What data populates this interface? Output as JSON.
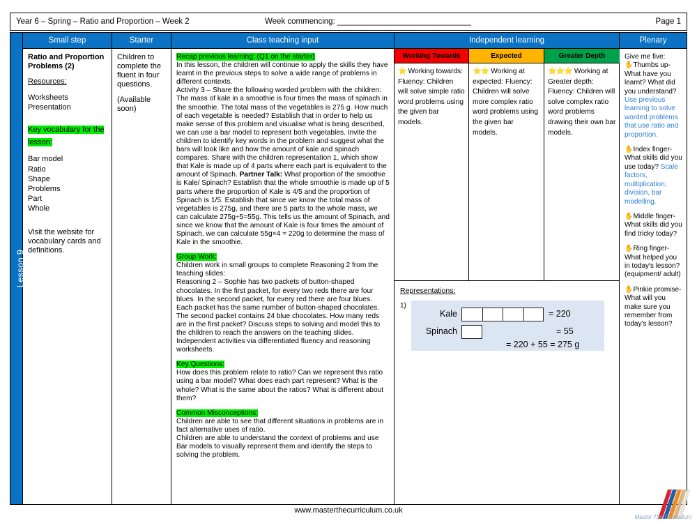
{
  "header": {
    "left": "Year 6 – Spring – Ratio and Proportion – Week 2",
    "week_commencing_label": "Week commencing: ______________________________",
    "page": "Page 1"
  },
  "spine": {
    "lesson_label": "Lesson 9"
  },
  "columns": {
    "small_step": "Small step",
    "starter": "Starter",
    "class_teaching_input": "Class teaching input",
    "independent_learning": "Independent learning",
    "plenary": "Plenary"
  },
  "small_step": {
    "title": "Ratio and Proportion Problems (2)",
    "resources_label": "Resources:",
    "resources": [
      "Worksheets",
      "Presentation"
    ],
    "vocab_heading": "Key vocabulary for the lesson:",
    "vocab": [
      "Bar model",
      "Ratio",
      "Shape",
      "Problems",
      "Part",
      "Whole"
    ],
    "footer_note": "Visit the website for vocabulary cards and definitions."
  },
  "starter": {
    "line1": "Children to complete the fluent in four questions.",
    "line2": "(Available soon)"
  },
  "teaching": {
    "recap_heading": "Recap previous learning: (Q1 on the starter)",
    "intro": "In this lesson, the children will continue to apply the skills they have learnt in the previous steps to solve a wide range of problems in different contexts.",
    "activity_part1": "Activity 3 – Share the following worded problem with the children: The mass of kale in a smoothie is four times the mass of spinach in the smoothie. The total mass of the vegetables is 275 g. How much of each vegetable is needed? Establish that in order to help us make sense of this problem and visualise what is being described, we can use a bar model to represent both vegetables. Invite the children to identify key words in the problem and suggest what the bars will look like and how the amount of kale and spinach compares. Share with the children representation 1, which show that Kale is made up of 4 parts where each part is equivalent to the amount of Spinach. ",
    "partner_talk_label": "Partner Talk:",
    "activity_part2": " What proportion of the smoothie is Kale/ Spinach? Establish that the whole smoothie is made up of 5 parts where the proportion of Kale is 4/5 and the proportion of Spinach is 1/5. Establish that since we know the total mass of vegetables is 275g, and there are 5 parts to the whole mass, we can calculate 275g÷5=55g. This tells us the amount of Spinach, and since we know that the amount of Kale is four times the amount of Spinach, we can calculate 55g×4 = 220g to determine the mass of Kale in the smoothie.",
    "group_work_heading": "Group Work:",
    "group_work": "Children work in small groups to complete Reasoning 2 from the teaching slides:",
    "reasoning": "Reasoning 2 – Sophie has two packets of button-shaped chocolates. In the first packet, for every two reds there are four blues. In the second packet, for every red there are four blues. Each packet has the same number of button-shaped chocolates. The second packet contains 24 blue chocolates. How many reds are in the first packet? Discuss steps to solving and model this to the children to reach the answers on the teaching slides.",
    "independent_note": "Independent activities via differentiated fluency and reasoning worksheets.",
    "key_questions_heading": "Key Questions:",
    "key_questions": "How does this problem relate to ratio? Can we represent this ratio using a bar model? What does each part represent? What is the whole? What is the same about the ratios? What is different about them?",
    "misconceptions_heading": "Common Misconceptions:",
    "misconception1": "Children are able to see that different situations in problems are in fact alternative uses of ratio.",
    "misconception2": "Children are able to understand the context of problems and use Bar models to visually represent them and identify the steps to solving the problem."
  },
  "differentiation": {
    "bands": [
      {
        "label": "Working Towards",
        "color": "#f20000",
        "stars": "⭐",
        "heading": "Working towards:",
        "body": "Fluency: Children will solve simple ratio word problems using the given bar models."
      },
      {
        "label": "Expected",
        "color": "#ffb400",
        "stars": "⭐⭐",
        "heading": "Working at expected:",
        "body": "Fluency: Children will solve more complex ratio word problems using the given bar models."
      },
      {
        "label": "Greater Depth",
        "color": "#00a14b",
        "stars": "⭐⭐⭐",
        "heading": "Working at Greater depth:",
        "body": "Fluency: Children will solve complex ratio word problems drawing their own bar models."
      }
    ]
  },
  "representations": {
    "title": "Representations:",
    "number": "1)",
    "bar_model": {
      "row1_label": "Kale",
      "row1_parts": 4,
      "row1_value": "= 220",
      "row2_label": "Spinach",
      "row2_parts": 1,
      "row2_value": "= 55",
      "total": "= 220 + 55 = 275 g"
    }
  },
  "plenary": {
    "intro": "Give me five:",
    "items": [
      {
        "hand": "✋",
        "prompt": "Thumbs up- What have you learnt? What did you understand?",
        "answer": "Use previous learning to solve worded problems  that use ratio and proportion."
      },
      {
        "hand": "✋",
        "prompt": "Index finger- What skills did you use today?",
        "answer": "Scale factors, multiplication, division, bar modelling."
      },
      {
        "hand": "✋",
        "prompt": "Middle finger- What skills did you find tricky today?",
        "answer": ""
      },
      {
        "hand": "✋",
        "prompt": "Ring finger- What helped you in today's lesson? (equipment/ adult)",
        "answer": ""
      },
      {
        "hand": "✋",
        "prompt": "Pinkie promise- What will you make sure you remember from today's lesson?",
        "answer": ""
      }
    ]
  },
  "footer": {
    "website": "www.masterthecurriculum.co.uk",
    "logo_text": "Master The Curriculum"
  }
}
